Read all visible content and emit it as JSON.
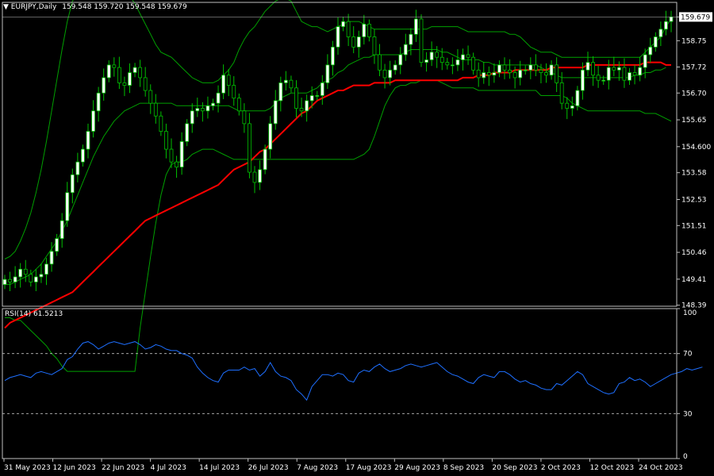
{
  "header": {
    "symbol": "EURJPY,Daily",
    "ohlc": "159.548 159.720 159.548 159.679",
    "rsi_label": "RSI(14) 61.5213"
  },
  "colors": {
    "background": "#000000",
    "bull_body": "#ffffff",
    "wick": "#00c000",
    "bollinger": "#00a000",
    "ma": "#ff0000",
    "rsi": "#1e6fff",
    "price_tag_bg": "#ffffff"
  },
  "chart_data": [
    {
      "type": "candlestick",
      "title": "EURJPY,Daily",
      "price_axis_ticks": [
        159.679,
        158.75,
        157.72,
        156.7,
        155.65,
        154.6,
        153.58,
        152.53,
        151.51,
        150.46,
        149.41,
        148.39
      ],
      "current_price": 159.679,
      "ylim": [
        148.35,
        160.25
      ],
      "date_labels": [
        "31 May 2023",
        "12 Jun 2023",
        "22 Jun 2023",
        "4 Jul 2023",
        "14 Jul 2023",
        "26 Jul 2023",
        "7 Aug 2023",
        "17 Aug 2023",
        "29 Aug 2023",
        "8 Sep 2023",
        "20 Sep 2023",
        "2 Oct 2023",
        "12 Oct 2023",
        "24 Oct 2023"
      ],
      "close": [
        149.4,
        149.3,
        149.5,
        149.8,
        149.6,
        149.3,
        149.5,
        149.6,
        150,
        150.5,
        151,
        151.7,
        152.8,
        153.5,
        154,
        154.5,
        155.2,
        156,
        156.7,
        157.3,
        157.8,
        157.7,
        157.1,
        157,
        157.5,
        157.7,
        157.3,
        156.8,
        156.3,
        155.8,
        155.2,
        154.5,
        154,
        153.8,
        154.8,
        155.5,
        156,
        156.1,
        156,
        156.2,
        156.3,
        156.7,
        157.4,
        157,
        156.5,
        156,
        155.5,
        153.6,
        153.2,
        153.7,
        154.5,
        155.5,
        156.4,
        157.1,
        157.2,
        156.9,
        156.1,
        156,
        156.4,
        156.6,
        156.6,
        157.1,
        157.8,
        158.5,
        159.3,
        159.5,
        158.9,
        158.5,
        158.9,
        159.4,
        158.9,
        158.2,
        157.6,
        157.3,
        157.6,
        157.8,
        158.2,
        158.6,
        159,
        159.6,
        157.9,
        158,
        158.3,
        158.1,
        157.9,
        157.8,
        157.8,
        158,
        158.2,
        158.1,
        157.6,
        157.3,
        157.5,
        157.4,
        157.5,
        157.8,
        157.6,
        157.5,
        157.3,
        157.6,
        157.6,
        157.8,
        157.6,
        157.5,
        157.4,
        157.8,
        157.1,
        156.3,
        156.1,
        156.2,
        156.8,
        157.6,
        157.9,
        157.4,
        157.2,
        157.2,
        157.7,
        157.6,
        157.7,
        157.2,
        157.5,
        157.4,
        157.7,
        158.2,
        158.5,
        158.9,
        159.2,
        159.5,
        159.68
      ],
      "series": [
        {
          "name": "",
          "kind": "upper_band",
          "values": [
            150.2,
            150.3,
            150.5,
            150.9,
            151.4,
            152,
            152.8,
            153.7,
            154.8,
            156,
            157.2,
            158.4,
            159.5,
            160.3,
            160.6,
            160.6,
            160.6,
            160.6,
            160.6,
            160.6,
            160.6,
            160.6,
            160.6,
            160.6,
            160.5,
            160.2,
            159.8,
            159.4,
            159,
            158.6,
            158.3,
            158.2,
            158.1,
            157.9,
            157.7,
            157.5,
            157.3,
            157.2,
            157.1,
            157.1,
            157.1,
            157.2,
            157.4,
            157.6,
            157.9,
            158.4,
            158.8,
            159.1,
            159.3,
            159.6,
            159.9,
            160.1,
            160.3,
            160.4,
            160.4,
            160.3,
            159.9,
            159.5,
            159.4,
            159.3,
            159.3,
            159.2,
            159.1,
            159.2,
            159.3,
            159.4,
            159.5,
            159.5,
            159.5,
            159.4,
            159.3,
            159.2,
            159.2,
            159.2,
            159.2,
            159.2,
            159.2,
            159.2,
            159.2,
            159.2,
            159.2,
            159.2,
            159.3,
            159.3,
            159.3,
            159.3,
            159.3,
            159.3,
            159.2,
            159.1,
            159.1,
            159.1,
            159.1,
            159.1,
            159.1,
            159.1,
            159.1,
            159,
            159,
            158.9,
            158.7,
            158.5,
            158.4,
            158.3,
            158.3,
            158.3,
            158.2,
            158.1,
            158.1,
            158.1,
            158.1,
            158.1,
            158.1,
            158.1,
            158.1,
            158.1,
            158.1,
            158.1,
            158.1,
            158.1,
            158.1,
            158.1,
            158.1,
            158.3,
            158.5,
            158.7,
            158.9,
            159.3,
            159.6
          ]
        },
        {
          "name": "",
          "kind": "middle_band",
          "values": [
            149.2,
            149.2,
            149.3,
            149.4,
            149.5,
            149.6,
            149.8,
            150,
            150.3,
            150.6,
            150.9,
            151.3,
            151.7,
            152.2,
            152.7,
            153.2,
            153.7,
            154.2,
            154.6,
            155,
            155.3,
            155.6,
            155.8,
            156,
            156.1,
            156.2,
            156.3,
            156.3,
            156.3,
            156.3,
            156.3,
            156.3,
            156.3,
            156.2,
            156.2,
            156.2,
            156.2,
            156.2,
            156.2,
            156.2,
            156.2,
            156.2,
            156.2,
            156.2,
            156.1,
            156,
            156,
            156,
            156,
            156,
            156,
            156.1,
            156.3,
            156.5,
            156.6,
            156.7,
            156.7,
            156.7,
            156.7,
            156.8,
            156.9,
            157.1,
            157.2,
            157.3,
            157.5,
            157.6,
            157.8,
            157.9,
            158,
            158.1,
            158.1,
            158.2,
            158.2,
            158.2,
            158.2,
            158.2,
            158.2,
            158.3,
            158.4,
            158.4,
            158.4,
            158.4,
            158.4,
            158.4,
            158.3,
            158.3,
            158.2,
            158.1,
            158,
            158,
            158,
            158,
            157.9,
            157.9,
            157.8,
            157.8,
            157.8,
            157.8,
            157.8,
            157.8,
            157.8,
            157.8,
            157.8,
            157.7,
            157.6,
            157.5,
            157.4,
            157.3,
            157.3,
            157.3,
            157.3,
            157.3,
            157.3,
            157.3,
            157.3,
            157.3,
            157.3,
            157.3,
            157.3,
            157.3,
            157.3,
            157.4,
            157.4,
            157.5,
            157.5,
            157.6,
            157.6,
            157.7
          ]
        },
        {
          "name": "",
          "kind": "lower_band",
          "values": [
            147.9,
            147.9,
            147.8,
            147.8,
            147.6,
            147.4,
            147.2,
            147,
            146.8,
            146.5,
            146.3,
            146,
            145.8,
            145.8,
            145.8,
            145.8,
            145.8,
            145.8,
            145.8,
            145.8,
            145.8,
            145.8,
            145.8,
            145.8,
            145.8,
            145.8,
            147.5,
            148.9,
            150.3,
            151.6,
            152.7,
            153.5,
            153.9,
            154,
            154,
            154.1,
            154.3,
            154.4,
            154.5,
            154.5,
            154.5,
            154.4,
            154.3,
            154.2,
            154.1,
            154.1,
            154.1,
            154.1,
            154.1,
            154.1,
            154.1,
            154.1,
            154.1,
            154.1,
            154.1,
            154.1,
            154.1,
            154.1,
            154.1,
            154.1,
            154.1,
            154.1,
            154.1,
            154.1,
            154.1,
            154.1,
            154.1,
            154.1,
            154.2,
            154.3,
            154.5,
            155,
            155.6,
            156.2,
            156.6,
            156.9,
            157,
            157,
            157.1,
            157.1,
            157.2,
            157.2,
            157.2,
            157.2,
            157.1,
            157,
            156.9,
            156.9,
            156.9,
            156.9,
            156.9,
            156.8,
            156.8,
            156.8,
            156.8,
            156.8,
            156.8,
            156.8,
            156.8,
            156.8,
            156.8,
            156.8,
            156.8,
            156.6,
            156.6,
            156.6,
            156.6,
            156.6,
            156.5,
            156.3,
            156.2,
            156.1,
            156,
            156,
            156,
            156,
            156,
            156,
            156,
            156,
            156,
            156,
            156,
            155.9,
            155.9,
            155.9,
            155.8,
            155.7,
            155.6
          ]
        },
        {
          "name": "",
          "kind": "moving_average",
          "values": [
            147.5,
            147.7,
            147.8,
            147.9,
            148,
            148.1,
            148.2,
            148.3,
            148.4,
            148.5,
            148.6,
            148.7,
            148.8,
            148.9,
            149.1,
            149.3,
            149.5,
            149.7,
            149.9,
            150.1,
            150.3,
            150.5,
            150.7,
            150.9,
            151.1,
            151.3,
            151.5,
            151.7,
            151.8,
            151.9,
            152,
            152.1,
            152.2,
            152.3,
            152.4,
            152.5,
            152.6,
            152.7,
            152.8,
            152.9,
            153,
            153.1,
            153.3,
            153.5,
            153.7,
            153.8,
            153.9,
            154,
            154.2,
            154.4,
            154.5,
            154.7,
            154.9,
            155.1,
            155.3,
            155.5,
            155.7,
            155.9,
            156,
            156.2,
            156.4,
            156.5,
            156.6,
            156.7,
            156.8,
            156.8,
            156.9,
            157,
            157,
            157,
            157,
            157.1,
            157.1,
            157.1,
            157.1,
            157.2,
            157.2,
            157.2,
            157.2,
            157.2,
            157.2,
            157.2,
            157.2,
            157.2,
            157.2,
            157.2,
            157.2,
            157.2,
            157.3,
            157.3,
            157.3,
            157.4,
            157.4,
            157.4,
            157.5,
            157.5,
            157.5,
            157.5,
            157.6,
            157.6,
            157.6,
            157.6,
            157.6,
            157.6,
            157.6,
            157.7,
            157.7,
            157.7,
            157.7,
            157.7,
            157.7,
            157.7,
            157.8,
            157.8,
            157.8,
            157.8,
            157.8,
            157.8,
            157.8,
            157.8,
            157.8,
            157.8,
            157.8,
            157.9,
            157.9,
            157.9,
            157.9,
            157.8,
            157.8
          ]
        }
      ]
    },
    {
      "type": "line",
      "title": "RSI(14) 61.5213",
      "ylim": [
        0,
        100
      ],
      "y_ticks": [
        100,
        70,
        30,
        0
      ],
      "levels": [
        70,
        30
      ],
      "series": [
        {
          "name": "",
          "values": [
            52,
            54,
            55,
            56,
            55,
            54,
            57,
            58,
            57,
            56,
            58,
            60,
            66,
            68,
            73,
            77,
            78,
            76,
            73,
            75,
            77,
            78,
            77,
            76,
            77,
            78,
            76,
            73,
            74,
            76,
            75,
            73,
            72,
            72,
            70,
            69,
            67,
            61,
            57,
            54,
            52,
            51,
            57,
            59,
            59,
            59,
            61,
            59,
            60,
            55,
            58,
            64,
            58,
            55,
            54,
            52,
            46,
            43,
            39,
            48,
            52,
            56,
            56,
            55,
            57,
            56,
            52,
            51,
            57,
            59,
            58,
            61,
            63,
            60,
            58,
            59,
            60,
            62,
            63,
            62,
            61,
            62,
            63,
            64,
            61,
            58,
            56,
            55,
            53,
            51,
            50,
            54,
            56,
            55,
            54,
            58,
            58,
            56,
            53,
            51,
            52,
            50,
            49,
            47,
            46,
            46,
            50,
            49,
            52,
            55,
            58,
            56,
            50,
            48,
            46,
            44,
            43,
            44,
            50,
            51,
            54,
            52,
            53,
            51,
            48,
            50,
            52,
            54,
            56,
            57,
            58,
            60,
            59,
            60,
            61
          ]
        }
      ]
    }
  ]
}
